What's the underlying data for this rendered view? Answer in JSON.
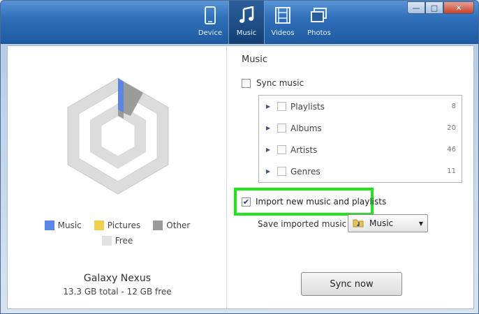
{
  "tabs": [
    {
      "label": "Device",
      "icon": "phone-icon",
      "active": false
    },
    {
      "label": "Music",
      "icon": "music-note-icon",
      "active": true
    },
    {
      "label": "Videos",
      "icon": "film-icon",
      "active": false
    },
    {
      "label": "Photos",
      "icon": "photos-icon",
      "active": false
    }
  ],
  "window_buttons": {
    "minimize": "—",
    "maximize": "□",
    "close": "✕"
  },
  "legend": {
    "music": {
      "label": "Music",
      "color": "#5b86e5"
    },
    "pictures": {
      "label": "Pictures",
      "color": "#f2d04f"
    },
    "other": {
      "label": "Other",
      "color": "#9b9b9b"
    },
    "free": {
      "label": "Free",
      "color": "#e2e2e2"
    }
  },
  "device": {
    "name": "Galaxy Nexus",
    "capacity": "13.3 GB total - 12 GB free"
  },
  "music_panel": {
    "title": "Music",
    "sync_label": "Sync music",
    "sync_checked": false,
    "tree": [
      {
        "label": "Playlists",
        "count": "8"
      },
      {
        "label": "Albums",
        "count": "20"
      },
      {
        "label": "Artists",
        "count": "46"
      },
      {
        "label": "Genres",
        "count": "11"
      }
    ],
    "import_label": "Import new music and playlists",
    "import_checked": true,
    "save_label": "Save imported music to",
    "save_value": "Music",
    "sync_button": "Sync now"
  },
  "colors": {
    "highlight": "#21e519",
    "accent": "#1f5aa0"
  }
}
